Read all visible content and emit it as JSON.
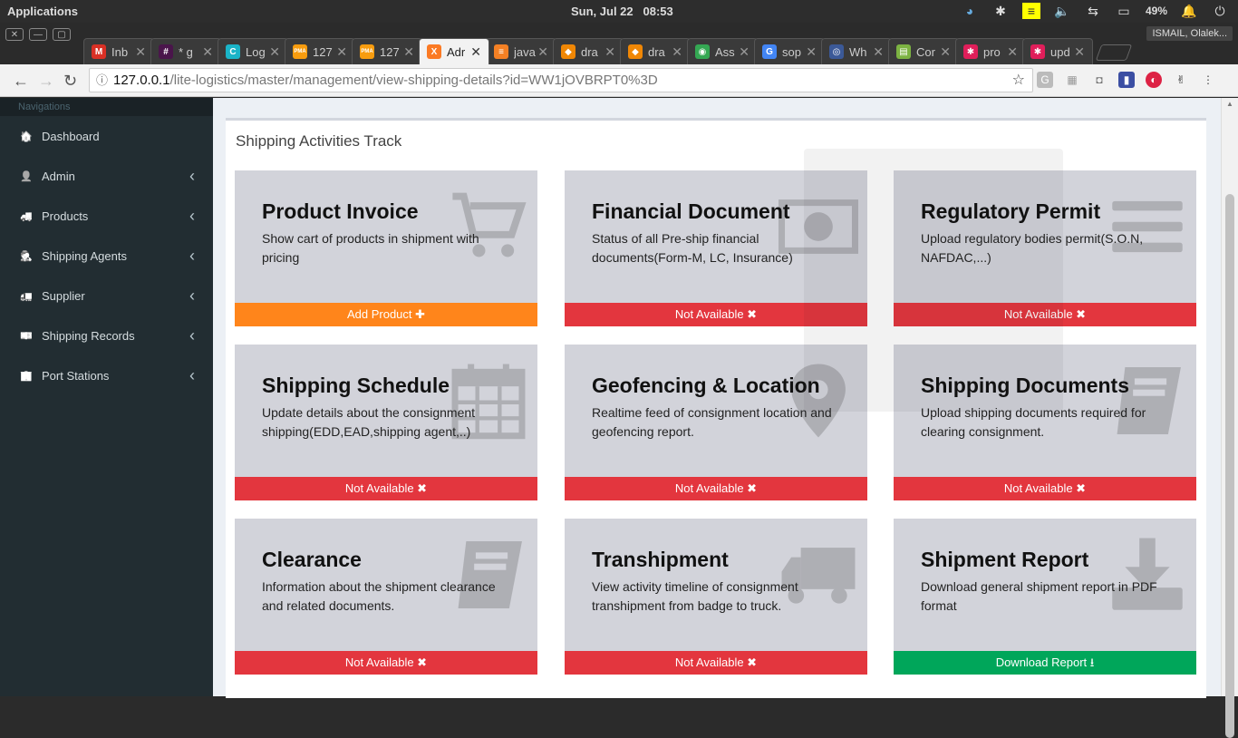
{
  "os": {
    "apps_label": "Applications",
    "date": "Sun, Jul 22",
    "time": "08:53",
    "battery": "49%"
  },
  "browser": {
    "profile": "ISMAIL, Olalek...",
    "tabs": [
      {
        "title": "Inb",
        "icon": "gmail-icon",
        "color": "#d93025",
        "glyph": "M"
      },
      {
        "title": "* g",
        "icon": "slack-hash-icon",
        "color": "#4a154b",
        "glyph": "#"
      },
      {
        "title": "Log",
        "icon": "c-logo-icon",
        "color": "#1ab4c8",
        "glyph": "C"
      },
      {
        "title": "127",
        "icon": "phpmyadmin-icon",
        "color": "#f89c0e",
        "glyph": "PMA"
      },
      {
        "title": "127",
        "icon": "phpmyadmin-icon",
        "color": "#f89c0e",
        "glyph": "PMA"
      },
      {
        "title": "Adr",
        "icon": "xampp-icon",
        "color": "#fb7a24",
        "glyph": "X"
      },
      {
        "title": "java",
        "icon": "stackoverflow-icon",
        "color": "#f48024",
        "glyph": "≡"
      },
      {
        "title": "dra",
        "icon": "drawio-icon",
        "color": "#f08705",
        "glyph": "◆"
      },
      {
        "title": "dra",
        "icon": "drawio-icon",
        "color": "#f08705",
        "glyph": "◆"
      },
      {
        "title": "Ass",
        "icon": "maps-icon",
        "color": "#34a853",
        "glyph": "◉"
      },
      {
        "title": "sop",
        "icon": "google-icon",
        "color": "#4285f4",
        "glyph": "G"
      },
      {
        "title": "Wh",
        "icon": "globe-icon",
        "color": "#3b5998",
        "glyph": "◎"
      },
      {
        "title": "Cor",
        "icon": "doc-icon",
        "color": "#7cb342",
        "glyph": "▤"
      },
      {
        "title": "pro",
        "icon": "slack-icon",
        "color": "#e01e5a",
        "glyph": "✱"
      },
      {
        "title": "upd",
        "icon": "slack-icon",
        "color": "#e01e5a",
        "glyph": "✱"
      }
    ],
    "active_tab_index": 5,
    "url_host": "127.0.0.1",
    "url_path": "/lite-logistics/master/management/view-shipping-details?id=WW1jOVBRPT0%3D"
  },
  "sidebar": {
    "header": "Navigations",
    "items": [
      {
        "label": "Dashboard",
        "icon": "dashboard-icon",
        "glyph": "🏠",
        "has_chevron": false
      },
      {
        "label": "Admin",
        "icon": "user-icon",
        "glyph": "👤",
        "has_chevron": true
      },
      {
        "label": "Products",
        "icon": "truck-icon",
        "glyph": "🚚",
        "has_chevron": true
      },
      {
        "label": "Shipping Agents",
        "icon": "user-secret-icon",
        "glyph": "🕵",
        "has_chevron": true
      },
      {
        "label": "Supplier",
        "icon": "truck-icon",
        "glyph": "🚛",
        "has_chevron": true
      },
      {
        "label": "Shipping Records",
        "icon": "money-icon",
        "glyph": "💵",
        "has_chevron": true
      },
      {
        "label": "Port Stations",
        "icon": "building-icon",
        "glyph": "🏢",
        "has_chevron": true
      }
    ]
  },
  "main": {
    "title": "Shipping Activities Track",
    "cards": [
      {
        "title": "Product Invoice",
        "desc": "Show cart of products in shipment with pricing",
        "action": "Add Product ✚",
        "status": "orange",
        "icon": "cart-icon"
      },
      {
        "title": "Financial Document",
        "desc": "Status of all Pre-ship financial documents(Form-M, LC, Insurance)",
        "action": "Not Available ✖",
        "status": "red",
        "icon": "banknote-icon"
      },
      {
        "title": "Regulatory Permit",
        "desc": "Upload regulatory bodies permit(S.O.N, NAFDAC,...)",
        "action": "Not Available ✖",
        "status": "red",
        "icon": "list-icon"
      },
      {
        "title": "Shipping Schedule",
        "desc": "Update details about the consignment shipping(EDD,EAD,shipping agent,..)",
        "action": "Not Available ✖",
        "status": "red",
        "icon": "calendar-icon"
      },
      {
        "title": "Geofencing & Location",
        "desc": "Realtime feed of consignment location and geofencing report.",
        "action": "Not Available ✖",
        "status": "red",
        "icon": "map-marker-icon"
      },
      {
        "title": "Shipping Documents",
        "desc": "Upload shipping documents required for clearing consignment.",
        "action": "Not Available ✖",
        "status": "red",
        "icon": "book-icon"
      },
      {
        "title": "Clearance",
        "desc": "Information about the shipment clearance and related documents.",
        "action": "Not Available ✖",
        "status": "red",
        "icon": "book-icon"
      },
      {
        "title": "Transhipment",
        "desc": "View activity timeline of consignment transhipment from badge to truck.",
        "action": "Not Available ✖",
        "status": "red",
        "icon": "truck-icon"
      },
      {
        "title": "Shipment Report",
        "desc": "Download general shipment report in PDF format",
        "action": "Download Report ⭳",
        "status": "green",
        "icon": "download-icon"
      }
    ]
  }
}
